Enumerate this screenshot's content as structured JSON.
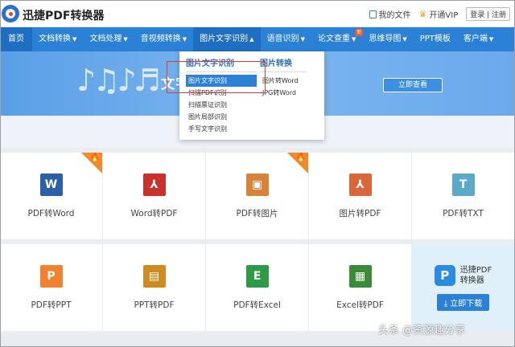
{
  "header": {
    "brand": "迅捷PDF转换器",
    "my_files": "我的文件",
    "vip": "开通VIP",
    "login": "登录 | 注册"
  },
  "nav": {
    "items": [
      {
        "label": "首页"
      },
      {
        "label": "文档转换"
      },
      {
        "label": "文档处理"
      },
      {
        "label": "音视频转换"
      },
      {
        "label": "图片文字识别"
      },
      {
        "label": "语音识别"
      },
      {
        "label": "论文查重",
        "badge": "新"
      },
      {
        "label": "思维导图"
      },
      {
        "label": "PPT模板"
      },
      {
        "label": "客户端"
      }
    ]
  },
  "banner": {
    "text": "文字 · · · 背景音",
    "button": "立即查看"
  },
  "dropdown": {
    "col1": {
      "title": "图片文字识别",
      "items": [
        "图片文字识别",
        "扫描PDF识别",
        "扫描票证识别",
        "图片局部识别",
        "手写文字识别"
      ]
    },
    "col2": {
      "title": "图片转换",
      "items": [
        "图片转Word",
        "JPG转Word"
      ]
    }
  },
  "tools": {
    "row1": [
      {
        "label": "PDF转Word",
        "icon_text": "W",
        "color": "#2b5fa8",
        "hot": true
      },
      {
        "label": "Word转PDF",
        "icon_text": "⅄",
        "color": "#c8322a",
        "hot": false
      },
      {
        "label": "PDF转图片",
        "icon_text": "▣",
        "color": "#d9823a",
        "hot": true
      },
      {
        "label": "图片转PDF",
        "icon_text": "⅄",
        "color": "#d9673a",
        "hot": false
      },
      {
        "label": "PDF转TXT",
        "icon_text": "T",
        "color": "#5aa9c8",
        "hot": false
      }
    ],
    "row2": [
      {
        "label": "PDF转PPT",
        "icon_text": "P",
        "color": "#f0812f"
      },
      {
        "label": "PPT转PDF",
        "icon_text": "▤",
        "color": "#d08a22"
      },
      {
        "label": "PDF转Excel",
        "icon_text": "E",
        "color": "#2f9a45"
      },
      {
        "label": "Excel转PDF",
        "icon_text": "▦",
        "color": "#3a8a3a"
      }
    ]
  },
  "ad": {
    "name_line1": "迅捷PDF",
    "name_line2": "转换器",
    "download": "立即下载"
  },
  "watermark": "头条 @资源趣分享"
}
